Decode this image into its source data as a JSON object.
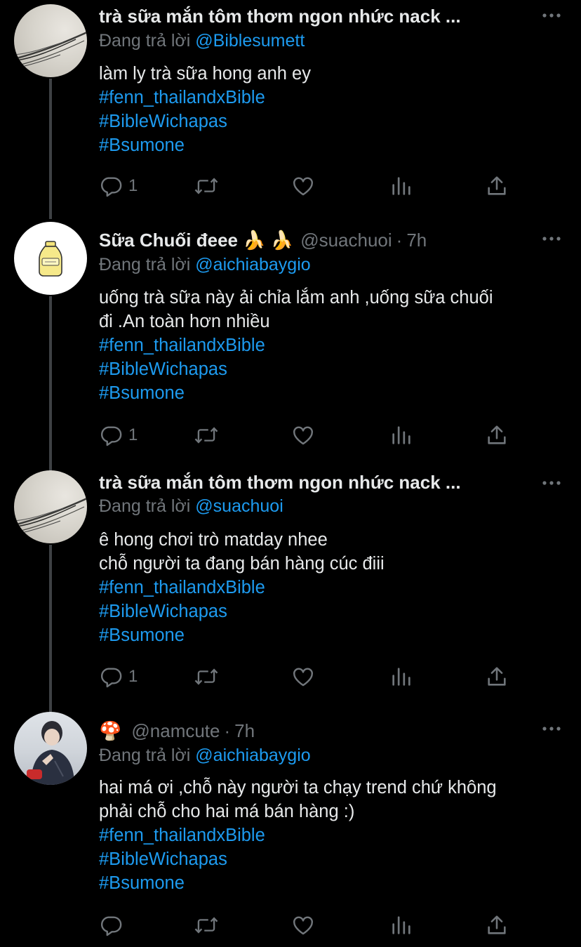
{
  "replying_prefix": "Đang trả lời",
  "tweets": [
    {
      "display_name": "trà sữa mắn tôm thơm ngon nhức nack ...",
      "handle": "",
      "time": "",
      "replying_to": "@Biblesumett",
      "text_lines": [
        "làm ly trà sữa hong anh ey"
      ],
      "hashtags": [
        "#fenn_thailandxBible",
        "#BibleWichapas",
        "#Bsumone"
      ],
      "reply_count": "1"
    },
    {
      "display_name": "Sữa Chuối đeee 🍌 🍌",
      "handle": "@suachuoi",
      "time": "7h",
      "replying_to": "@aichiabaygio",
      "text_lines": [
        "uống trà sữa này ải chỉa lắm anh ,uống sữa chuối",
        "đi .An toàn hơn nhiều"
      ],
      "hashtags": [
        "#fenn_thailandxBible",
        "#BibleWichapas",
        "#Bsumone"
      ],
      "reply_count": "1"
    },
    {
      "display_name": "trà sữa mắn tôm thơm ngon nhức nack ...",
      "handle": "",
      "time": "",
      "replying_to": "@suachuoi",
      "text_lines": [
        "ê hong chơi trò matday nhee",
        "chỗ người ta đang bán hàng cúc điii"
      ],
      "hashtags": [
        "#fenn_thailandxBible",
        "#BibleWichapas",
        "#Bsumone"
      ],
      "reply_count": "1"
    },
    {
      "display_name": "🍄",
      "handle": "@namcute",
      "time": "7h",
      "replying_to": "@aichiabaygio",
      "text_lines": [
        "hai má ơi ,chỗ này người ta chạy trend chứ không",
        "phải chỗ cho hai má bán hàng :)"
      ],
      "hashtags": [
        "#fenn_thailandxBible",
        "#BibleWichapas",
        "#Bsumone"
      ],
      "reply_count": ""
    }
  ],
  "colors": {
    "background": "#000000",
    "text": "#e7e9ea",
    "secondary": "#71767b",
    "link": "#1d9bf0",
    "thread_line": "#3e4144"
  },
  "icons": [
    "reply-icon",
    "retweet-icon",
    "like-icon",
    "views-icon",
    "share-icon",
    "more-icon"
  ]
}
